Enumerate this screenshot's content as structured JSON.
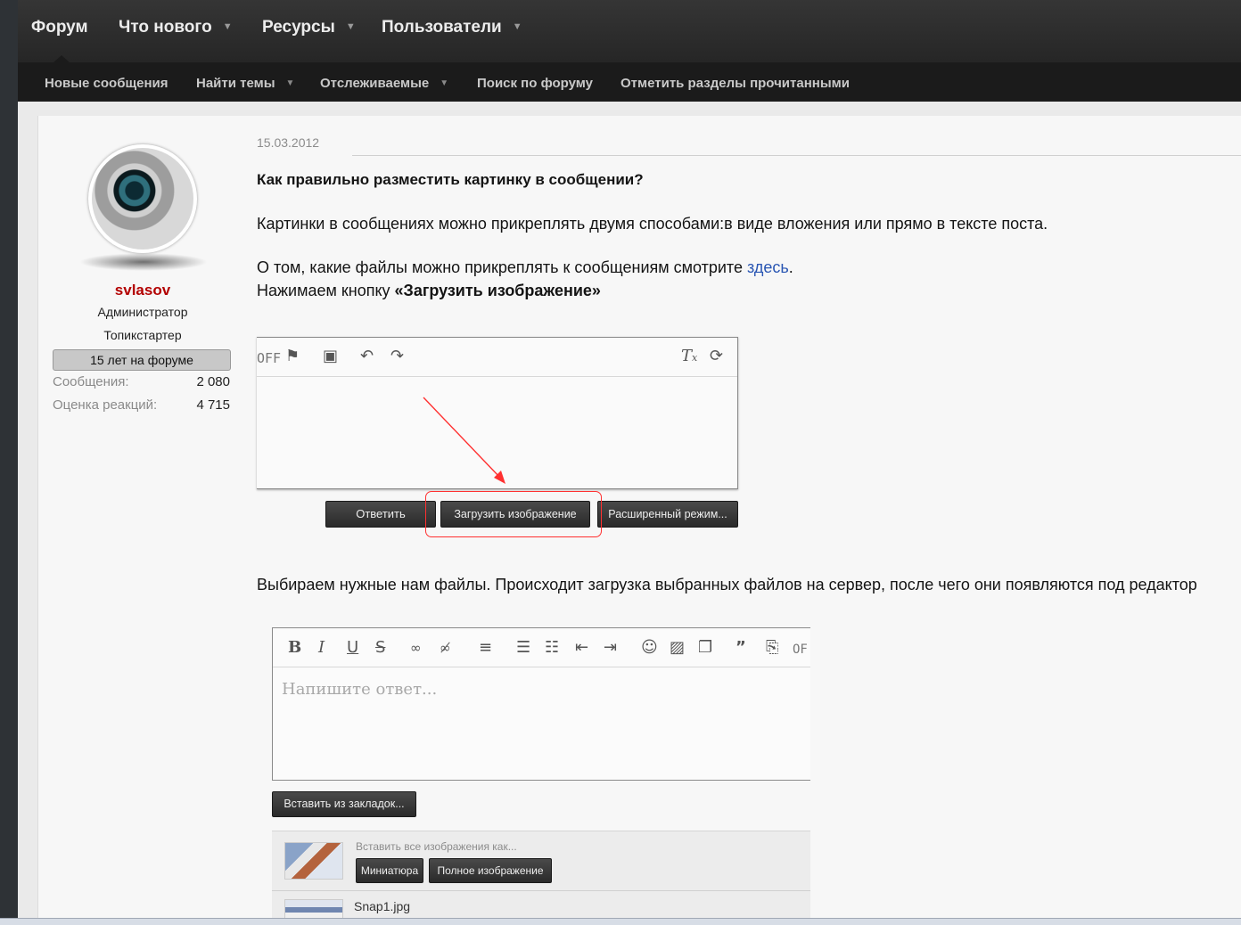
{
  "nav": {
    "tabs": [
      {
        "label": "Форум",
        "caret": false
      },
      {
        "label": "Что нового",
        "caret": true
      },
      {
        "label": "Ресурсы",
        "caret": true
      },
      {
        "label": "Пользователи",
        "caret": true
      }
    ],
    "subnav": [
      {
        "label": "Новые сообщения",
        "caret": false
      },
      {
        "label": "Найти темы",
        "caret": true
      },
      {
        "label": "Отслеживаемые",
        "caret": true
      },
      {
        "label": "Поиск по форуму",
        "caret": false
      },
      {
        "label": "Отметить разделы прочитанными",
        "caret": false
      }
    ]
  },
  "user": {
    "name": "svlasov",
    "title": "Администратор",
    "role": "Топикстартер",
    "banner": "15 лет на форуме",
    "stats": [
      {
        "label": "Сообщения:",
        "value": "2 080"
      },
      {
        "label": "Оценка реакций:",
        "value": "4 715"
      }
    ]
  },
  "post": {
    "date": "15.03.2012",
    "heading": "Как правильно разместить картинку в сообщении?",
    "p1": "Картинки в сообщениях можно прикреплять двумя способами:в виде вложения или прямо в тексте поста.",
    "p2_before": "О том, какие файлы можно прикреплять к сообщениям смотрите ",
    "p2_link": "здесь",
    "p2_after": ".",
    "p3_before": "Нажимаем кнопку ",
    "p3_bold": "«Загрузить изображение»",
    "p4": "Выбираем нужные нам файлы. Происходит загрузка выбранных файлов на сервер, после чего они появляются под редактор"
  },
  "editor1": {
    "toolbar_icons": [
      "bbcode-off-icon",
      "flag-icon",
      "save-icon",
      "undo-icon",
      "redo-icon",
      "remove-format-icon",
      "restore-icon"
    ],
    "buttons": {
      "reply": "Ответить",
      "upload": "Загрузить изображение",
      "advanced": "Расширенный режим..."
    }
  },
  "editor2": {
    "toolbar_icons": [
      "bold-icon",
      "italic-icon",
      "underline-icon",
      "strike-icon",
      "link-icon",
      "unlink-icon",
      "align-icon",
      "bullet-list-icon",
      "numbered-list-icon",
      "outdent-icon",
      "indent-icon",
      "smilie-icon",
      "image-icon",
      "media-icon",
      "quote-icon",
      "code-icon",
      "bbcode-off-icon"
    ],
    "placeholder": "Напишите ответ...",
    "insert_bookmarks": "Вставить из закладок...",
    "insert_all_label": "Вставить все изображения как...",
    "thumbnail_button": "Миниатюра",
    "full_image_button": "Полное изображение",
    "file_name": "Snap1.jpg"
  },
  "colors": {
    "username": "#b30000",
    "link": "#2a56b3",
    "highlight": "#ff3030"
  }
}
